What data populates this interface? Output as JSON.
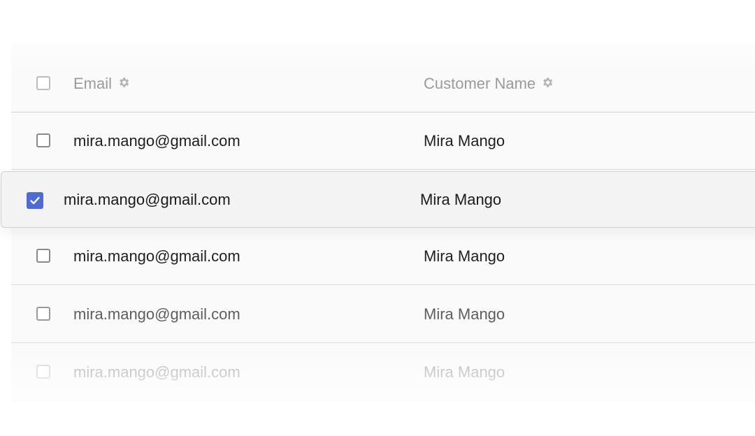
{
  "table": {
    "columns": {
      "email": "Email",
      "customer_name": "Customer Name"
    },
    "rows": [
      {
        "email": "mira.mango@gmail.com",
        "customer_name": "Mira Mango",
        "selected": false
      },
      {
        "email": "mira.mango@gmail.com",
        "customer_name": "Mira Mango",
        "selected": true
      },
      {
        "email": "mira.mango@gmail.com",
        "customer_name": "Mira Mango",
        "selected": false
      },
      {
        "email": "mira.mango@gmail.com",
        "customer_name": "Mira Mango",
        "selected": false
      },
      {
        "email": "mira.mango@gmail.com",
        "customer_name": "Mira Mango",
        "selected": false
      }
    ]
  },
  "icons": {
    "column_settings": "gear-icon",
    "row_selected": "checkmark-icon"
  },
  "colors": {
    "accent": "#4f6bd1",
    "header_text": "#9a9a9a",
    "row_text": "#1f1f1f"
  }
}
